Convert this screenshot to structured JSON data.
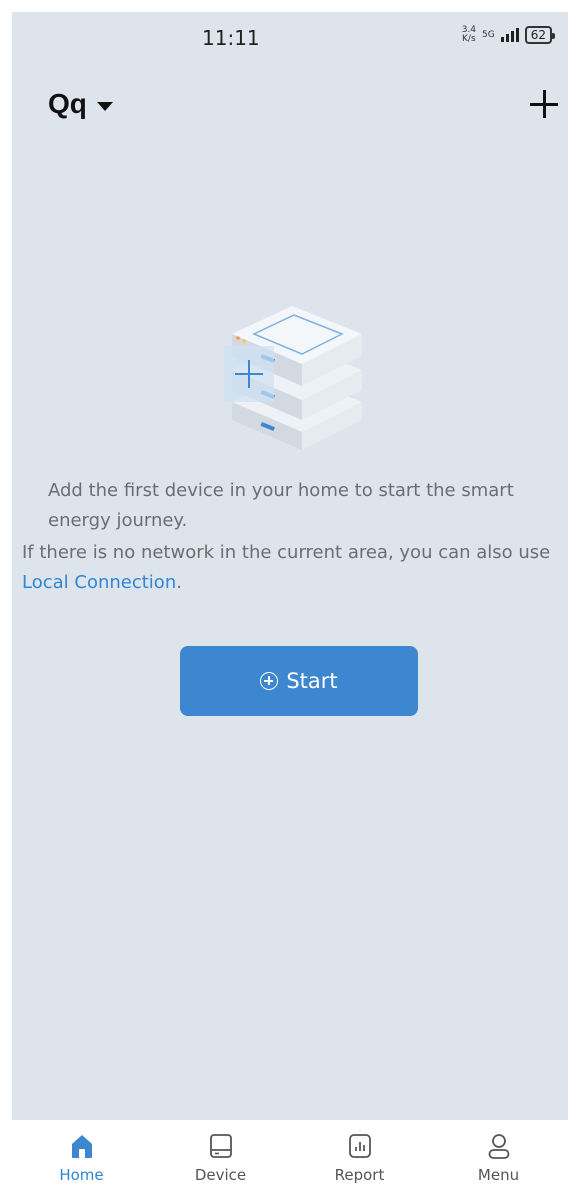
{
  "status_bar": {
    "time": "11:11",
    "net_speed_value": "3.4",
    "net_speed_unit": "K/s",
    "network_type": "5G",
    "battery": "62"
  },
  "header": {
    "home_name": "Qq",
    "add_icon": "plus-icon"
  },
  "empty_state": {
    "illustration": "stacked-devices-illustration",
    "message_line1": "Add the first device in your home to start the smart energy journey.",
    "message_line2_prefix": "If there is no network in the current area, you can also use ",
    "local_connection_link": "Local Connection",
    "message_line2_suffix": ".",
    "start_button_label": "Start"
  },
  "bottom_nav": {
    "items": [
      {
        "label": "Home",
        "icon": "home-icon",
        "active": true
      },
      {
        "label": "Device",
        "icon": "device-icon",
        "active": false
      },
      {
        "label": "Report",
        "icon": "report-icon",
        "active": false
      },
      {
        "label": "Menu",
        "icon": "user-icon",
        "active": false
      }
    ]
  },
  "colors": {
    "accent": "#3c87d0",
    "link": "#2f86d6",
    "background": "#dde4ec",
    "text_muted": "#6a6e74"
  }
}
